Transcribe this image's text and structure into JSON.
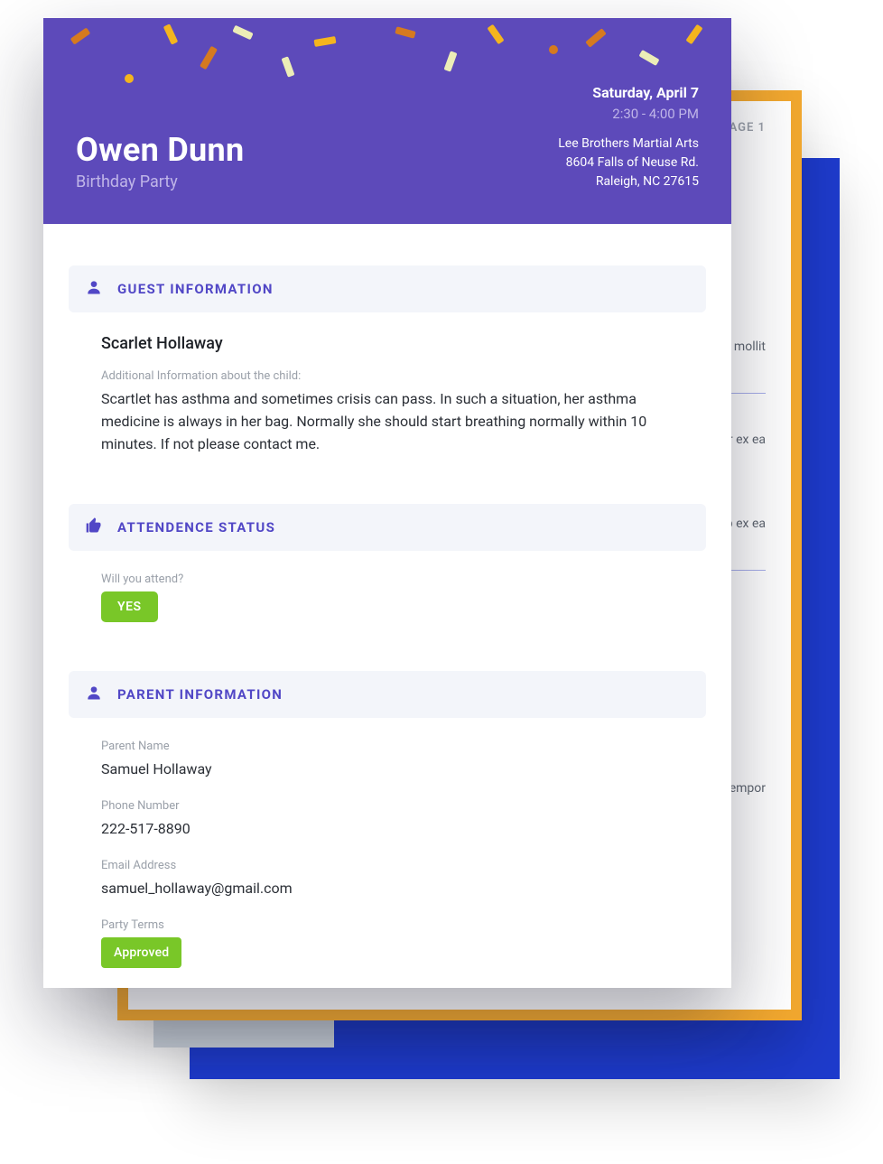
{
  "back_orange": {
    "page_tag": "AGE 1",
    "paragraphs": [
      "empor ostrud e irure ariatur. mollit",
      "empor ex ea",
      "empor aliquip ex ea",
      "empor"
    ]
  },
  "header": {
    "title": "Owen Dunn",
    "subtitle": "Birthday Party",
    "date": "Saturday, April 7",
    "time": "2:30 - 4:00 PM",
    "venue": "Lee Brothers Martial Arts",
    "address1": "8604 Falls of Neuse Rd.",
    "address2": "Raleigh, NC 27615"
  },
  "sections": {
    "guest_title": "GUEST INFORMATION",
    "attendance_title": "ATTENDENCE STATUS",
    "parent_title": "PARENT INFORMATION"
  },
  "guest": {
    "name": "Scarlet Hollaway",
    "additional_label": "Additional Information about the child:",
    "additional_value": "Scartlet has asthma and sometimes crisis can pass. In such a situation, her asthma medicine is always in her bag. Normally she should start breathing normally within 10 minutes. If not please contact me."
  },
  "attendance": {
    "question": "Will you attend?",
    "answer": "YES"
  },
  "parent": {
    "name_label": "Parent Name",
    "name_value": "Samuel Hollaway",
    "phone_label": "Phone Number",
    "phone_value": "222-517-8890",
    "email_label": "Email Address",
    "email_value": "samuel_hollaway@gmail.com",
    "terms_label": "Party Terms",
    "terms_value": "Approved"
  }
}
